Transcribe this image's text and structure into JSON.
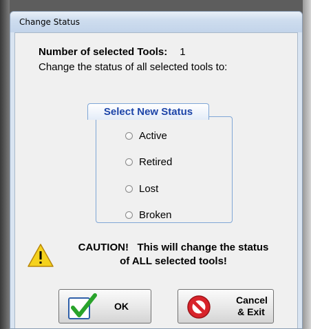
{
  "window": {
    "title": "Change Status"
  },
  "info": {
    "count_label": "Number of selected Tools:",
    "count_value": "1",
    "instruction": "Change the status of all selected tools to:"
  },
  "status_group": {
    "title": "Select New Status",
    "options": [
      {
        "label": "Active",
        "selected": false
      },
      {
        "label": "Retired",
        "selected": false
      },
      {
        "label": "Lost",
        "selected": false
      },
      {
        "label": "Broken",
        "selected": false
      }
    ]
  },
  "caution": {
    "line1": "CAUTION!   This will change the status",
    "line2": "of ALL selected tools!"
  },
  "buttons": {
    "ok": {
      "label": "OK",
      "icon": "green-checkmark-icon"
    },
    "cancel": {
      "line1": "Cancel",
      "line2": "& Exit",
      "icon": "red-prohibited-icon"
    }
  },
  "colors": {
    "group_title": "#1c44a8",
    "group_border": "#7fa6d6",
    "caution_yellow": "#f5d21d",
    "ok_green": "#29a32b",
    "cancel_red": "#d8232a"
  }
}
